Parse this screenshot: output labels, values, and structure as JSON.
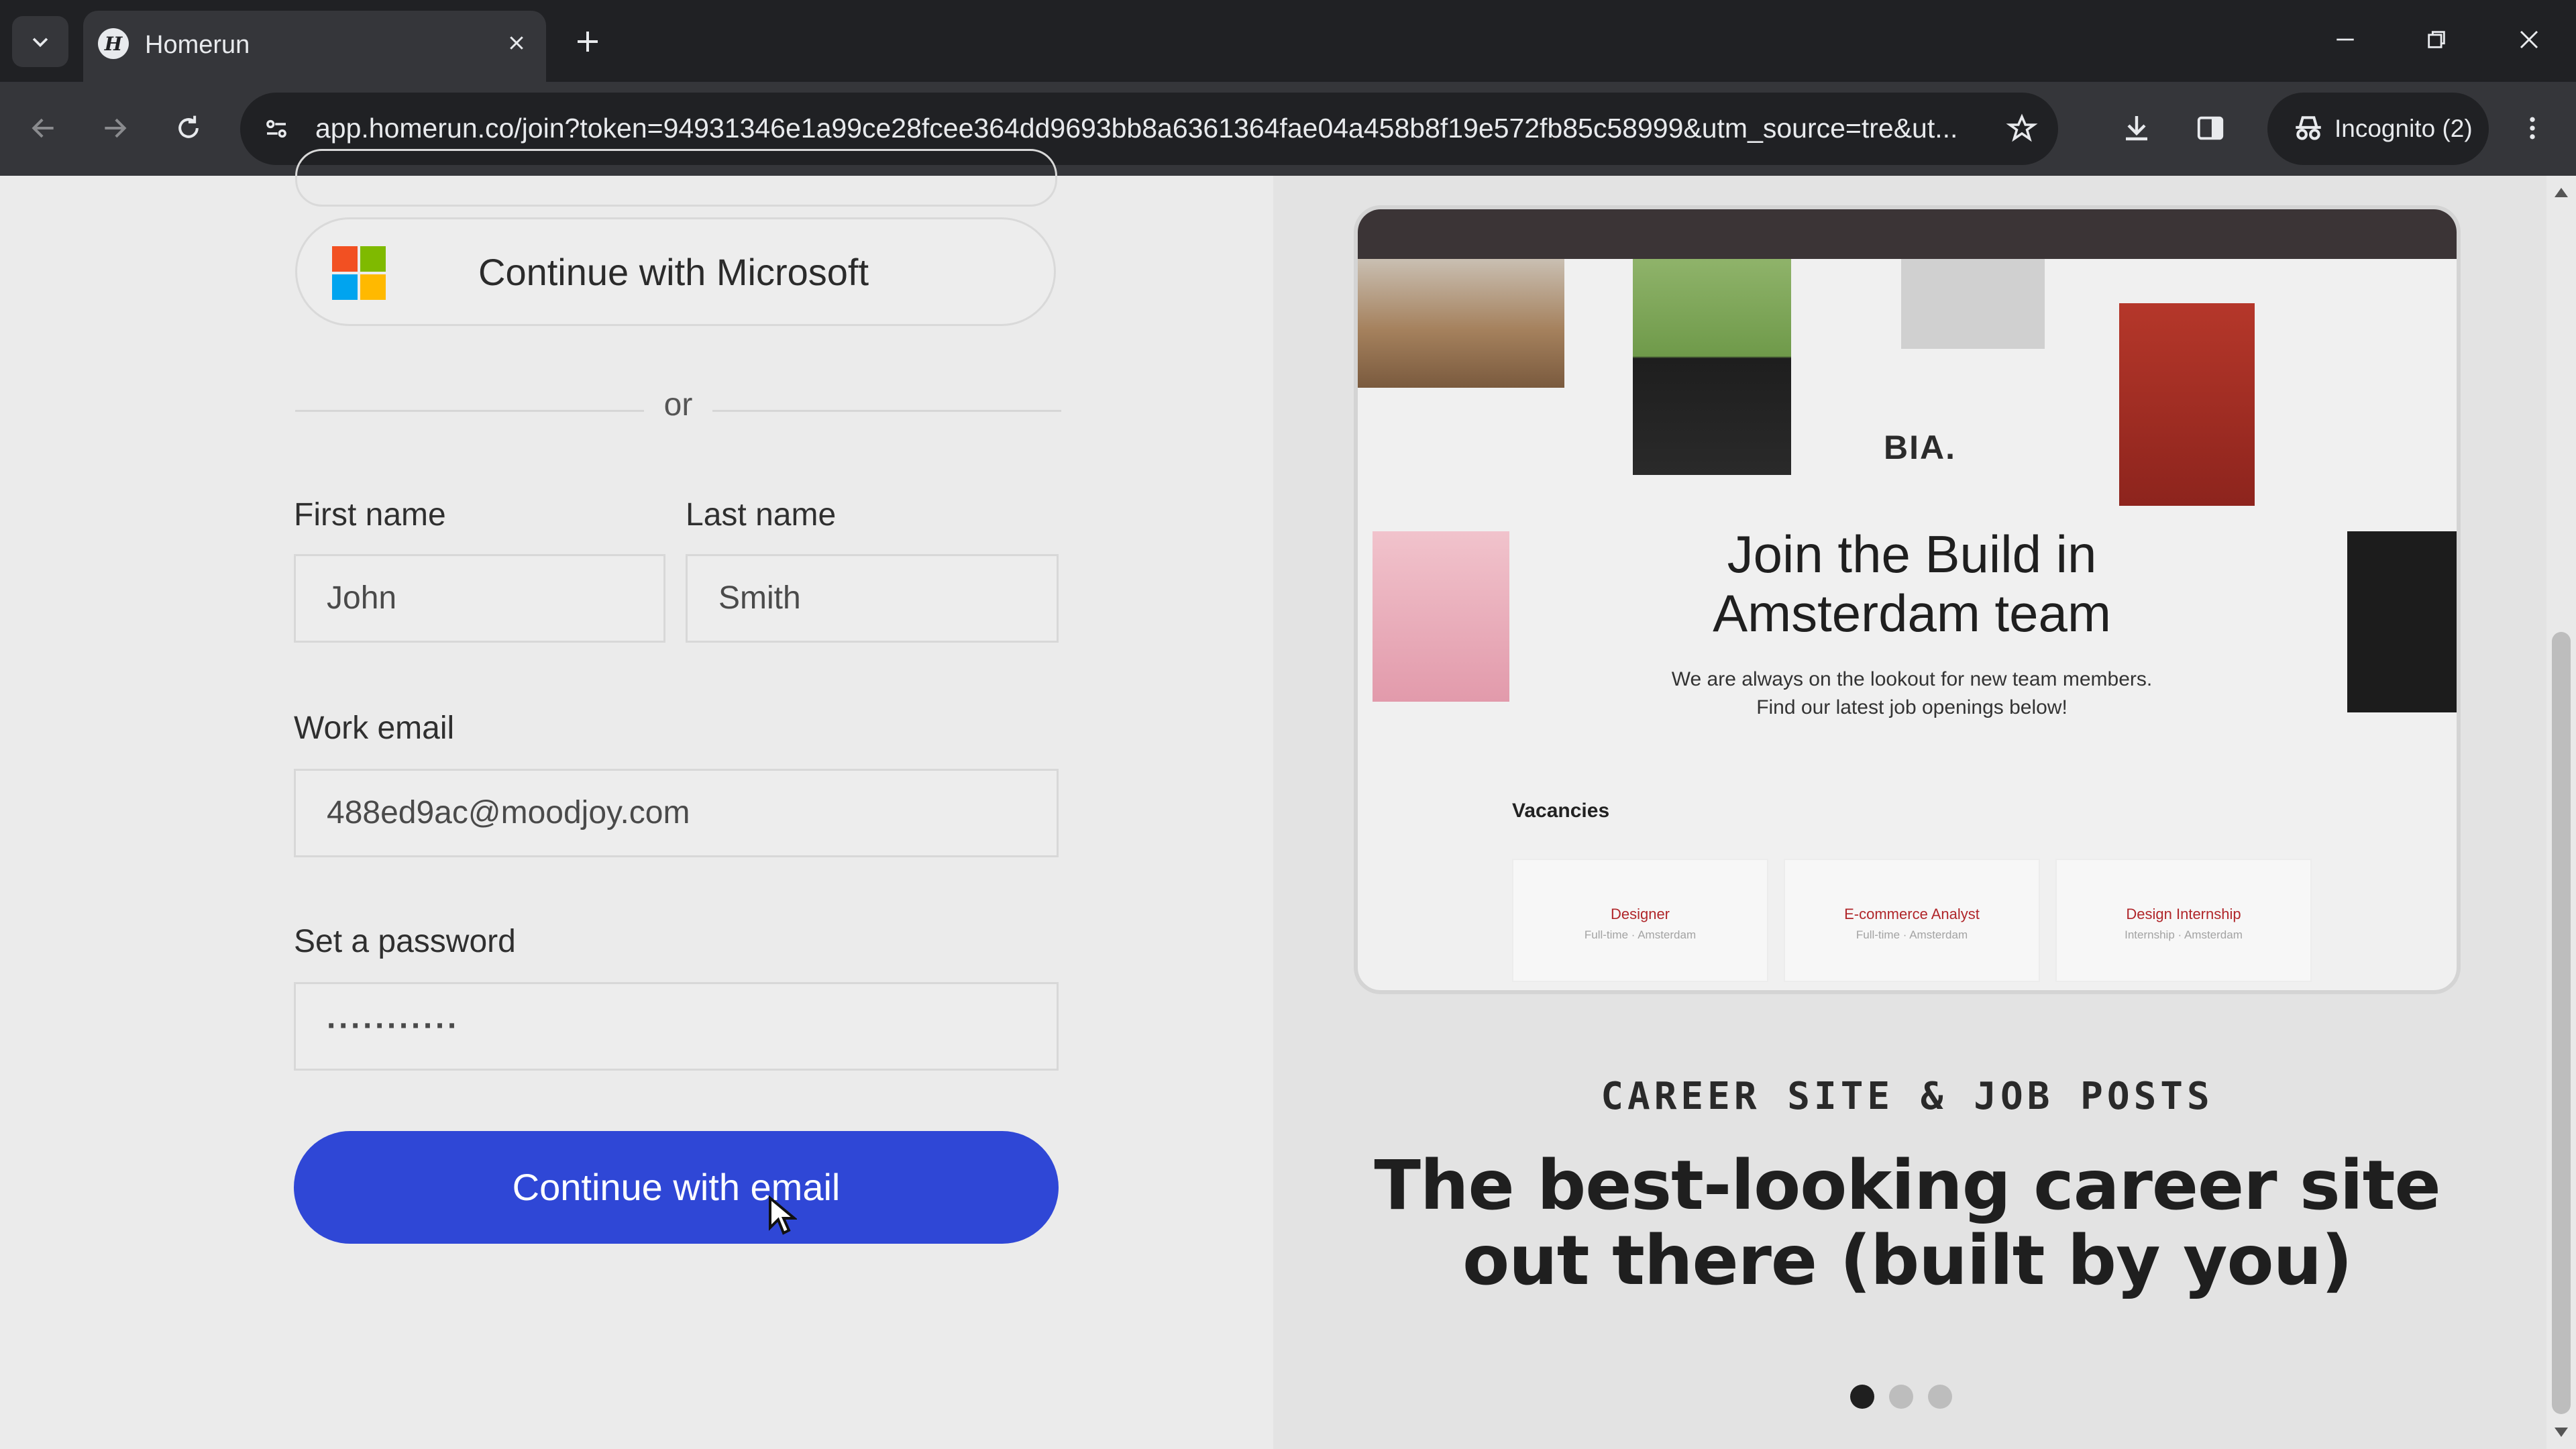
{
  "browser": {
    "tab_title": "Homerun",
    "favicon_letter": "H",
    "url": "app.homerun.co/join?token=94931346e1a99ce28fcee364dd9693bb8a6361364fae04a458b8f19e572fb85c58999&utm_source=tre&ut...",
    "incognito_label": "Incognito (2)"
  },
  "auth": {
    "microsoft_button": "Continue with Microsoft",
    "divider": "or"
  },
  "form": {
    "first_name_label": "First name",
    "first_name_value": "John",
    "last_name_label": "Last name",
    "last_name_value": "Smith",
    "email_label": "Work email",
    "email_value": "488ed9ac@moodjoy.com",
    "password_label": "Set a password",
    "password_value": "···········",
    "submit": "Continue with email"
  },
  "preview": {
    "logo": "BIA.",
    "title": "Join the Build in Amsterdam team",
    "subtitle": "We are always on the lookout for new team members. Find our latest job openings below!",
    "vacancies_heading": "Vacancies",
    "vacancies": [
      {
        "title": "Designer",
        "meta": "Full-time · Amsterdam"
      },
      {
        "title": "E-commerce Analyst",
        "meta": "Full-time · Amsterdam"
      },
      {
        "title": "Design Internship",
        "meta": "Internship · Amsterdam"
      }
    ]
  },
  "promo": {
    "eyebrow": "CAREER SITE & JOB POSTS",
    "headline": "The best-looking career site out there (built by you)",
    "carousel": {
      "count": 3,
      "active": 1
    }
  },
  "colors": {
    "primary": "#2f47d6",
    "ms_red": "#f25022",
    "ms_green": "#7fba00",
    "ms_blue": "#00a4ef",
    "ms_yellow": "#ffb900"
  },
  "icons": [
    "tab-search-icon",
    "close-icon",
    "plus-icon",
    "minimize-icon",
    "restore-icon",
    "back-icon",
    "forward-icon",
    "reload-icon",
    "site-info-icon",
    "star-icon",
    "download-icon",
    "side-panel-icon",
    "incognito-icon",
    "menu-icon",
    "microsoft-logo-icon",
    "cursor-icon"
  ]
}
